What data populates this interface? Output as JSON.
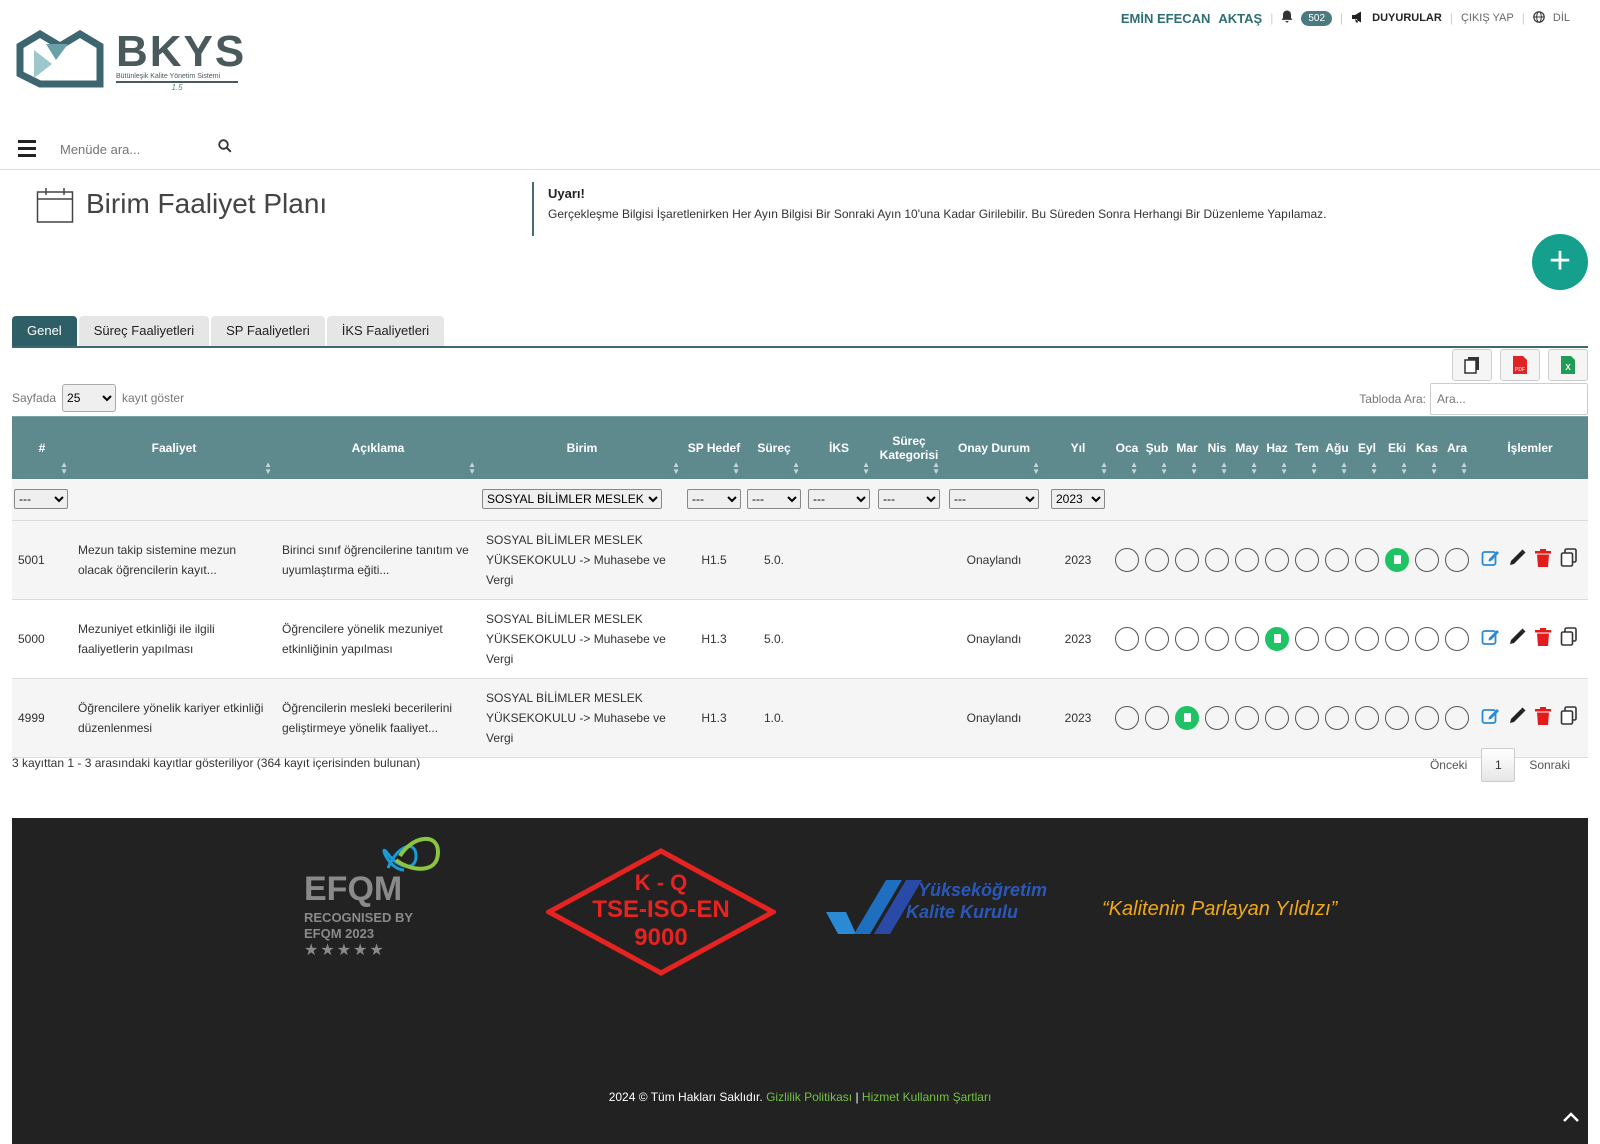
{
  "header": {
    "logo_text": "BKYS",
    "logo_subtitle": "Bütünleşik Kalite Yönetim Sistemi",
    "logo_version": "1.5",
    "user_first": "EMİN EFECAN",
    "user_last": "AKTAŞ",
    "notification_count": "502",
    "announcements": "DUYURULAR",
    "logout": "ÇIKIŞ YAP",
    "language": "DİL",
    "menu_search_placeholder": "Menüde ara..."
  },
  "page": {
    "title": "Birim Faaliyet Planı",
    "warning_title": "Uyarı!",
    "warning_text": "Gerçekleşme Bilgisi İşaretlenirken Her Ayın Bilgisi Bir Sonraki Ayın 10'una Kadar Girilebilir. Bu Süreden Sonra Herhangi Bir Düzenleme Yapılamaz.",
    "add_button": "+"
  },
  "tabs": [
    {
      "label": "Genel",
      "active": true
    },
    {
      "label": "Süreç Faaliyetleri",
      "active": false
    },
    {
      "label": "SP Faaliyetleri",
      "active": false
    },
    {
      "label": "İKS Faaliyetleri",
      "active": false
    }
  ],
  "table_controls": {
    "length_prefix": "Sayfada",
    "length_value": "25",
    "length_suffix": "kayıt göster",
    "search_label": "Tabloda Ara:",
    "search_placeholder": "Ara..."
  },
  "filters": {
    "first": "---",
    "birim": "SOSYAL BİLİMLER MESLEK YÜKSEKOKULU",
    "sp_hedef": "---",
    "surec": "---",
    "iks": "---",
    "surec_kat": "---",
    "onay": "---",
    "yil": "2023"
  },
  "columns": {
    "id": "#",
    "faaliyet": "Faaliyet",
    "aciklama": "Açıklama",
    "birim": "Birim",
    "sp_hedef": "SP Hedef",
    "surec": "Süreç",
    "iks": "İKS",
    "surec_kat_1": "Süreç",
    "surec_kat_2": "Kategorisi",
    "onay": "Onay Durum",
    "yil": "Yıl",
    "months": [
      "Oca",
      "Şub",
      "Mar",
      "Nis",
      "May",
      "Haz",
      "Tem",
      "Ağu",
      "Eyl",
      "Eki",
      "Kas",
      "Ara"
    ],
    "islemler": "İşlemler"
  },
  "rows": [
    {
      "id": "5001",
      "faaliyet": "Mezun takip sistemine mezun olacak öğrencilerin kayıt...",
      "aciklama": "Birinci sınıf öğrencilerine tanıtım ve uyumlaştırma eğiti...",
      "birim": "SOSYAL BİLİMLER MESLEK YÜKSEKOKULU -> Muhasebe ve Vergi",
      "sp_hedef": "H1.5",
      "surec": "5.0.",
      "iks": "",
      "surec_kat": "",
      "onay": "Onaylandı",
      "yil": "2023",
      "done_months": [
        9
      ]
    },
    {
      "id": "5000",
      "faaliyet": "Mezuniyet etkinliği ile ilgili faaliyetlerin yapılması",
      "aciklama": "Öğrencilere yönelik mezuniyet etkinliğinin yapılması",
      "birim": "SOSYAL BİLİMLER MESLEK YÜKSEKOKULU -> Muhasebe ve Vergi",
      "sp_hedef": "H1.3",
      "surec": "5.0.",
      "iks": "",
      "surec_kat": "",
      "onay": "Onaylandı",
      "yil": "2023",
      "done_months": [
        5
      ]
    },
    {
      "id": "4999",
      "faaliyet": "Öğrencilere yönelik kariyer etkinliği düzenlenmesi",
      "aciklama": "Öğrencilerin mesleki becerilerini geliştirmeye yönelik faaliyet...",
      "birim": "SOSYAL BİLİMLER MESLEK YÜKSEKOKULU -> Muhasebe ve Vergi",
      "sp_hedef": "H1.3",
      "surec": "1.0.",
      "iks": "",
      "surec_kat": "",
      "onay": "Onaylandı",
      "yil": "2023",
      "done_months": [
        2
      ]
    }
  ],
  "table_info": "3 kayıttan 1 - 3 arasındaki kayıtlar gösteriliyor (364 kayıt içerisinden bulunan)",
  "pager": {
    "prev": "Önceki",
    "page": "1",
    "next": "Sonraki"
  },
  "footer": {
    "efqm_title": "EFQM",
    "efqm_line1": "RECOGNISED BY",
    "efqm_line2": "EFQM 2023",
    "efqm_stars": "★★★★★",
    "tse_line1": "K - Q",
    "tse_line2": "TSE-ISO-EN",
    "tse_line3": "9000",
    "yok_line1": "Yükseköğretim",
    "yok_line2": "Kalite Kurulu",
    "slogan": "“Kalitenin Parlayan Yıldızı”",
    "copyright": "2024 © Tüm Hakları Saklıdır.",
    "privacy": "Gizlilik Politikası",
    "divider": "|",
    "terms": "Hizmet Kullanım Şartları"
  },
  "colors": {
    "primary": "#2e5e66",
    "header_bg": "#5e8a8e",
    "add_button": "#14a08c",
    "done": "#1fc365",
    "edit": "#2a8ad4",
    "delete": "#e31b1b",
    "footer_bg": "#222222",
    "slogan": "#f0a818"
  }
}
